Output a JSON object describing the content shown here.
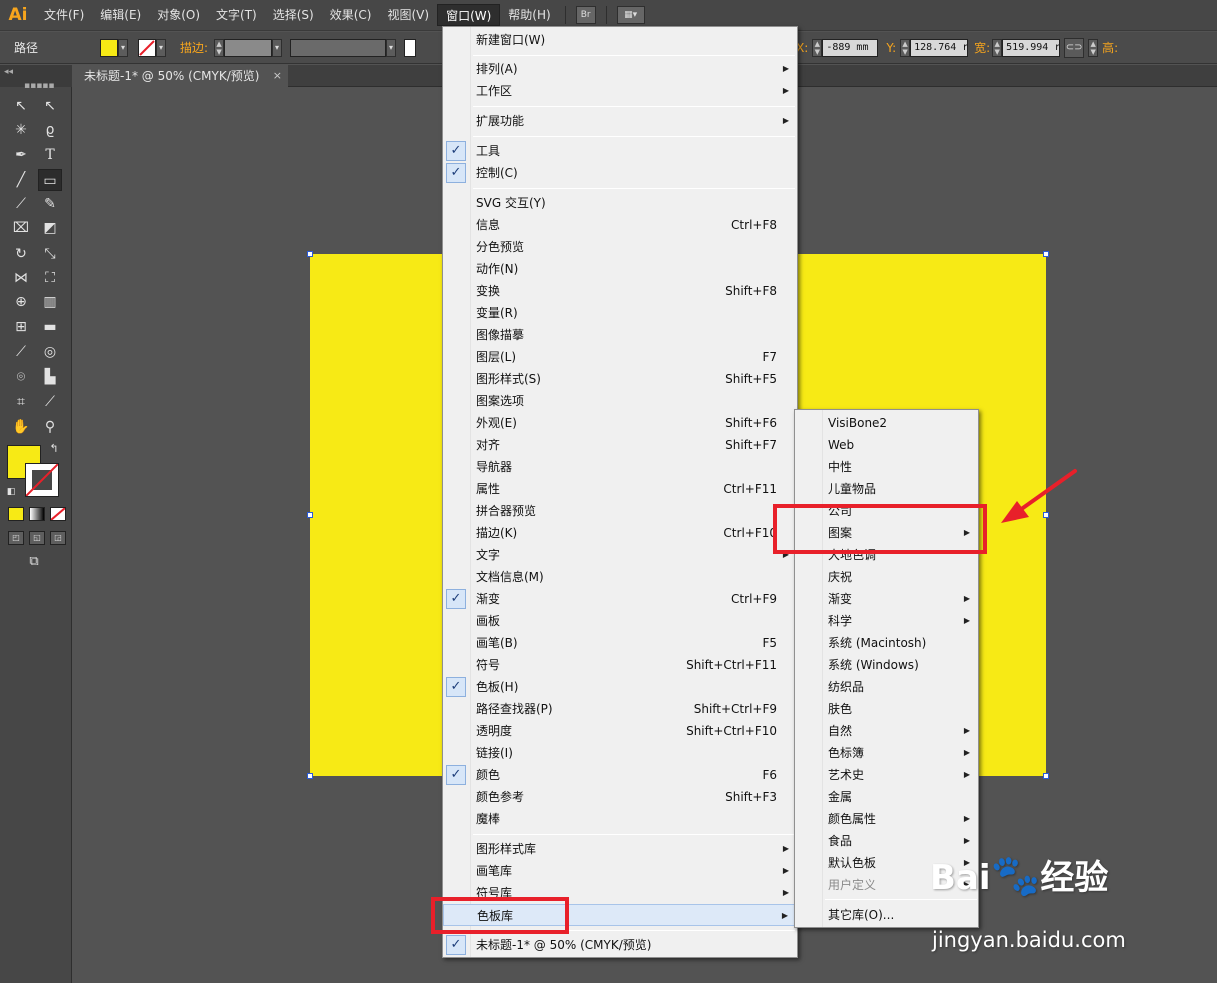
{
  "app": {
    "logo": "Ai"
  },
  "menubar": {
    "items": [
      "文件(F)",
      "编辑(E)",
      "对象(O)",
      "文字(T)",
      "选择(S)",
      "效果(C)",
      "视图(V)",
      "窗口(W)",
      "帮助(H)"
    ],
    "bridge_label": "Br"
  },
  "controlbar": {
    "object_type": "路径",
    "stroke_label": "描边:",
    "x_label": "X:",
    "x_value": "-889 mm",
    "y_label": "Y:",
    "y_value": "128.764 r",
    "w_label": "宽:",
    "w_value": "519.994 r",
    "h_label": "高:",
    "fill_color": "#f7ea15"
  },
  "document": {
    "tab_title": "未标题-1* @ 50% (CMYK/预览)",
    "close_glyph": "×"
  },
  "window_menu": {
    "new_window": "新建窗口(W)",
    "arrange": "排列(A)",
    "workspace": "工作区",
    "extensions": "扩展功能",
    "tools": "工具",
    "control": "控制(C)",
    "svg": "SVG 交互(Y)",
    "info": "信息",
    "info_sc": "Ctrl+F8",
    "sep_preview": "分色预览",
    "actions": "动作(N)",
    "transform": "变换",
    "transform_sc": "Shift+F8",
    "variables": "变量(R)",
    "image_trace": "图像描摹",
    "layers": "图层(L)",
    "layers_sc": "F7",
    "graphic_styles": "图形样式(S)",
    "graphic_styles_sc": "Shift+F5",
    "pattern_options": "图案选项",
    "appearance": "外观(E)",
    "appearance_sc": "Shift+F6",
    "align": "对齐",
    "align_sc": "Shift+F7",
    "navigator": "导航器",
    "attributes": "属性",
    "attributes_sc": "Ctrl+F11",
    "flattener": "拼合器预览",
    "stroke": "描边(K)",
    "stroke_sc": "Ctrl+F10",
    "type": "文字",
    "doc_info": "文档信息(M)",
    "gradient": "渐变",
    "gradient_sc": "Ctrl+F9",
    "artboards": "画板",
    "brushes": "画笔(B)",
    "brushes_sc": "F5",
    "symbols": "符号",
    "symbols_sc": "Shift+Ctrl+F11",
    "swatches": "色板(H)",
    "pathfinder": "路径查找器(P)",
    "pathfinder_sc": "Shift+Ctrl+F9",
    "transparency": "透明度",
    "transparency_sc": "Shift+Ctrl+F10",
    "links": "链接(I)",
    "color": "颜色",
    "color_sc": "F6",
    "color_guide": "颜色参考",
    "color_guide_sc": "Shift+F3",
    "magic_wand": "魔棒",
    "graphic_style_libs": "图形样式库",
    "brush_libs": "画笔库",
    "symbol_libs": "符号库",
    "swatch_libs": "色板库",
    "doc_window": "未标题-1* @ 50% (CMYK/预览)",
    "check_glyph": "✓",
    "arrow_glyph": "▶"
  },
  "swatch_submenu": {
    "items": [
      "VisiBone2",
      "Web",
      "中性",
      "儿童物品",
      "公司",
      "图案",
      "大地色调",
      "庆祝",
      "渐变",
      "科学",
      "系统 (Macintosh)",
      "系统 (Windows)",
      "纺织品",
      "肤色",
      "自然",
      "色标簿",
      "艺术史",
      "金属",
      "颜色属性",
      "食品",
      "默认色板",
      "用户定义",
      "其它库(O)..."
    ]
  },
  "watermark": {
    "brand": "Bai",
    "brand2": "经验",
    "url": "jingyan.baidu.com"
  },
  "colors": {
    "canvas": "#535353",
    "artboard_fill": "#f7ea15",
    "annotation_red": "#e8202a",
    "menu_bg": "#f0f0f0"
  }
}
